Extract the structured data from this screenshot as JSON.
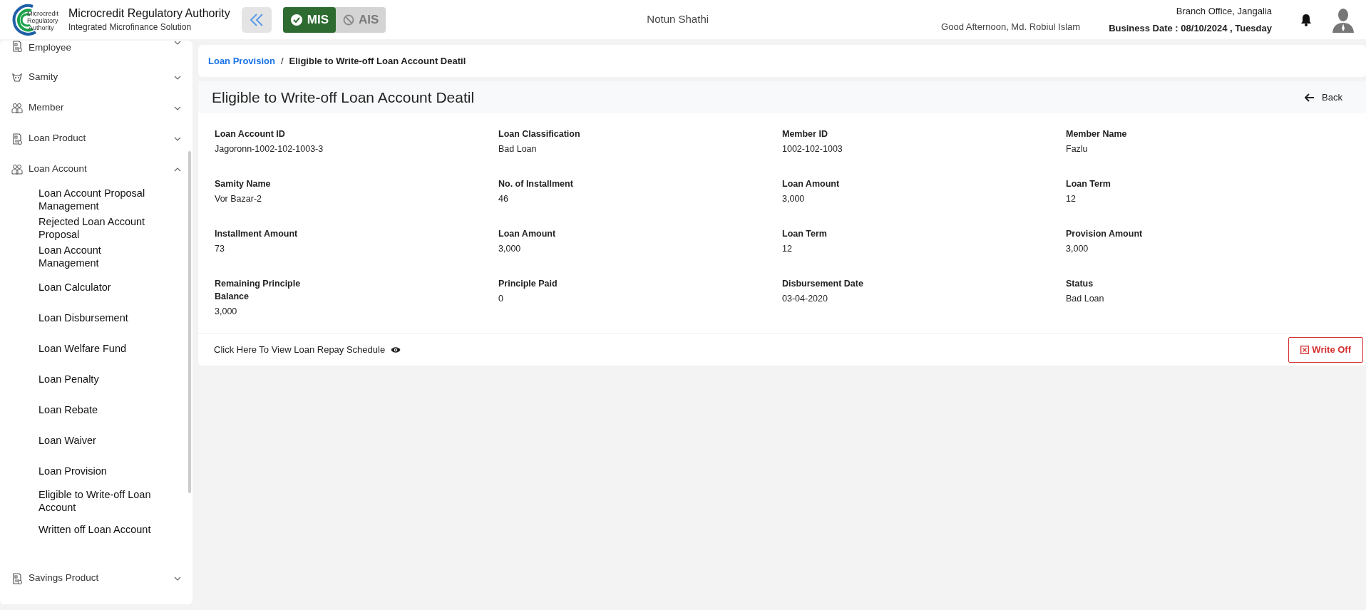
{
  "header": {
    "logo_text": [
      "Microcredit",
      "Regulatory",
      "Authority"
    ],
    "org_name": "Microcredit Regulatory Authority",
    "org_subtitle": "Integrated Microfinance Solution",
    "modes": [
      {
        "label": "MIS",
        "selected": true
      },
      {
        "label": "AIS",
        "selected": false
      }
    ],
    "center_title": "Notun Shathi",
    "greeting": "Good Afternoon, Md. Robiul Islam",
    "branch": "Branch Office, Jangalia",
    "business_date": "Business Date : 08/10/2024 , Tuesday"
  },
  "sidebar": {
    "items": [
      {
        "label": "Employee",
        "expanded": false
      },
      {
        "label": "Samity",
        "expanded": false
      },
      {
        "label": "Member",
        "expanded": false
      },
      {
        "label": "Loan Product",
        "expanded": false
      },
      {
        "label": "Loan Account",
        "expanded": true,
        "children": [
          {
            "label": "Loan Account Proposal Management"
          },
          {
            "label": "Rejected Loan Account Proposal"
          },
          {
            "label": "Loan Account Management"
          },
          {
            "label": "Loan Calculator"
          },
          {
            "label": "Loan Disbursement"
          },
          {
            "label": "Loan Welfare Fund"
          },
          {
            "label": "Loan Penalty"
          },
          {
            "label": "Loan Rebate"
          },
          {
            "label": "Loan Waiver"
          },
          {
            "label": "Loan Provision"
          },
          {
            "label": "Eligible to Write-off Loan Account"
          },
          {
            "label": "Written off Loan Account"
          }
        ]
      },
      {
        "label": "Savings Product",
        "expanded": false
      }
    ]
  },
  "breadcrumb": [
    {
      "label": "Loan Provision",
      "kind": "link"
    },
    {
      "label": "/",
      "kind": "separator"
    },
    {
      "label": "Eligible to Write-off Loan Account Deatil",
      "kind": "current"
    }
  ],
  "panel": {
    "title": "Eligible to Write-off Loan Account Deatil",
    "back_label": "Back",
    "fields": [
      {
        "label": "Loan Account ID",
        "value": "Jagoronn-1002-102-1003-3"
      },
      {
        "label": "Loan Classification",
        "value": "Bad Loan"
      },
      {
        "label": "Member ID",
        "value": "1002-102-1003"
      },
      {
        "label": "Member Name",
        "value": "Fazlu"
      },
      {
        "label": "Samity Name",
        "value": "Vor Bazar-2"
      },
      {
        "label": "No. of Installment",
        "value": "46"
      },
      {
        "label": "Loan Amount",
        "value": "3,000"
      },
      {
        "label": "Loan Term",
        "value": "12"
      },
      {
        "label": "Installment Amount",
        "value": "73"
      },
      {
        "label": "Loan Amount",
        "value": "3,000"
      },
      {
        "label": "Loan Term",
        "value": "12"
      },
      {
        "label": "Provision Amount",
        "value": "3,000"
      },
      {
        "label": "Remaining Principle Balance",
        "value": "3,000"
      },
      {
        "label": "Principle Paid",
        "value": "0"
      },
      {
        "label": "Disbursement Date",
        "value": "03-04-2020"
      },
      {
        "label": "Status",
        "value": "Bad Loan"
      }
    ],
    "schedule_link": "Click Here To View Loan Repay Schedule",
    "write_off_label": "Write Off"
  }
}
